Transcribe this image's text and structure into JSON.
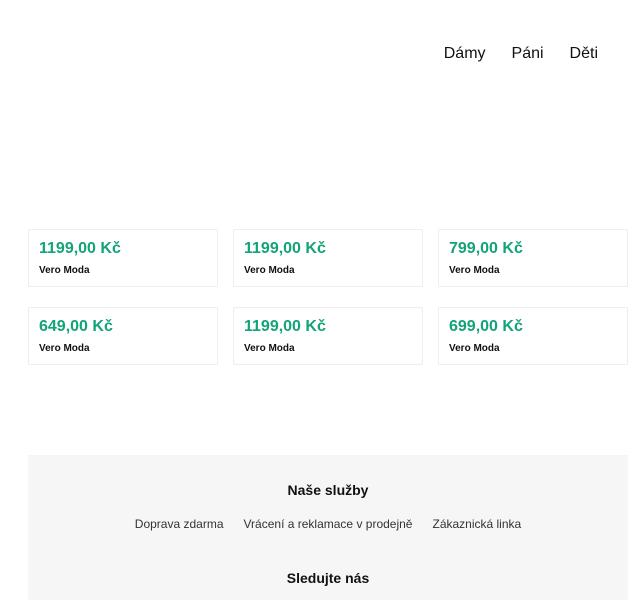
{
  "nav": {
    "items": [
      {
        "label": "Dámy"
      },
      {
        "label": "Páni"
      },
      {
        "label": "Děti"
      }
    ]
  },
  "products": [
    {
      "price": "1199,00 Kč",
      "brand": "Vero Moda"
    },
    {
      "price": "1199,00 Kč",
      "brand": "Vero Moda"
    },
    {
      "price": "799,00 Kč",
      "brand": "Vero Moda"
    },
    {
      "price": "649,00 Kč",
      "brand": "Vero Moda"
    },
    {
      "price": "1199,00 Kč",
      "brand": "Vero Moda"
    },
    {
      "price": "699,00 Kč",
      "brand": "Vero Moda"
    }
  ],
  "footer": {
    "services_title": "Naše služby",
    "services_links": [
      {
        "label": "Doprava zdarma"
      },
      {
        "label": "Vrácení a reklamace v prodejně"
      },
      {
        "label": "Zákaznická linka"
      }
    ],
    "follow_title": "Sledujte nás"
  },
  "colors": {
    "price_accent": "#12a37a",
    "footer_background": "#f6f6f6",
    "card_border": "#eeeeee"
  }
}
